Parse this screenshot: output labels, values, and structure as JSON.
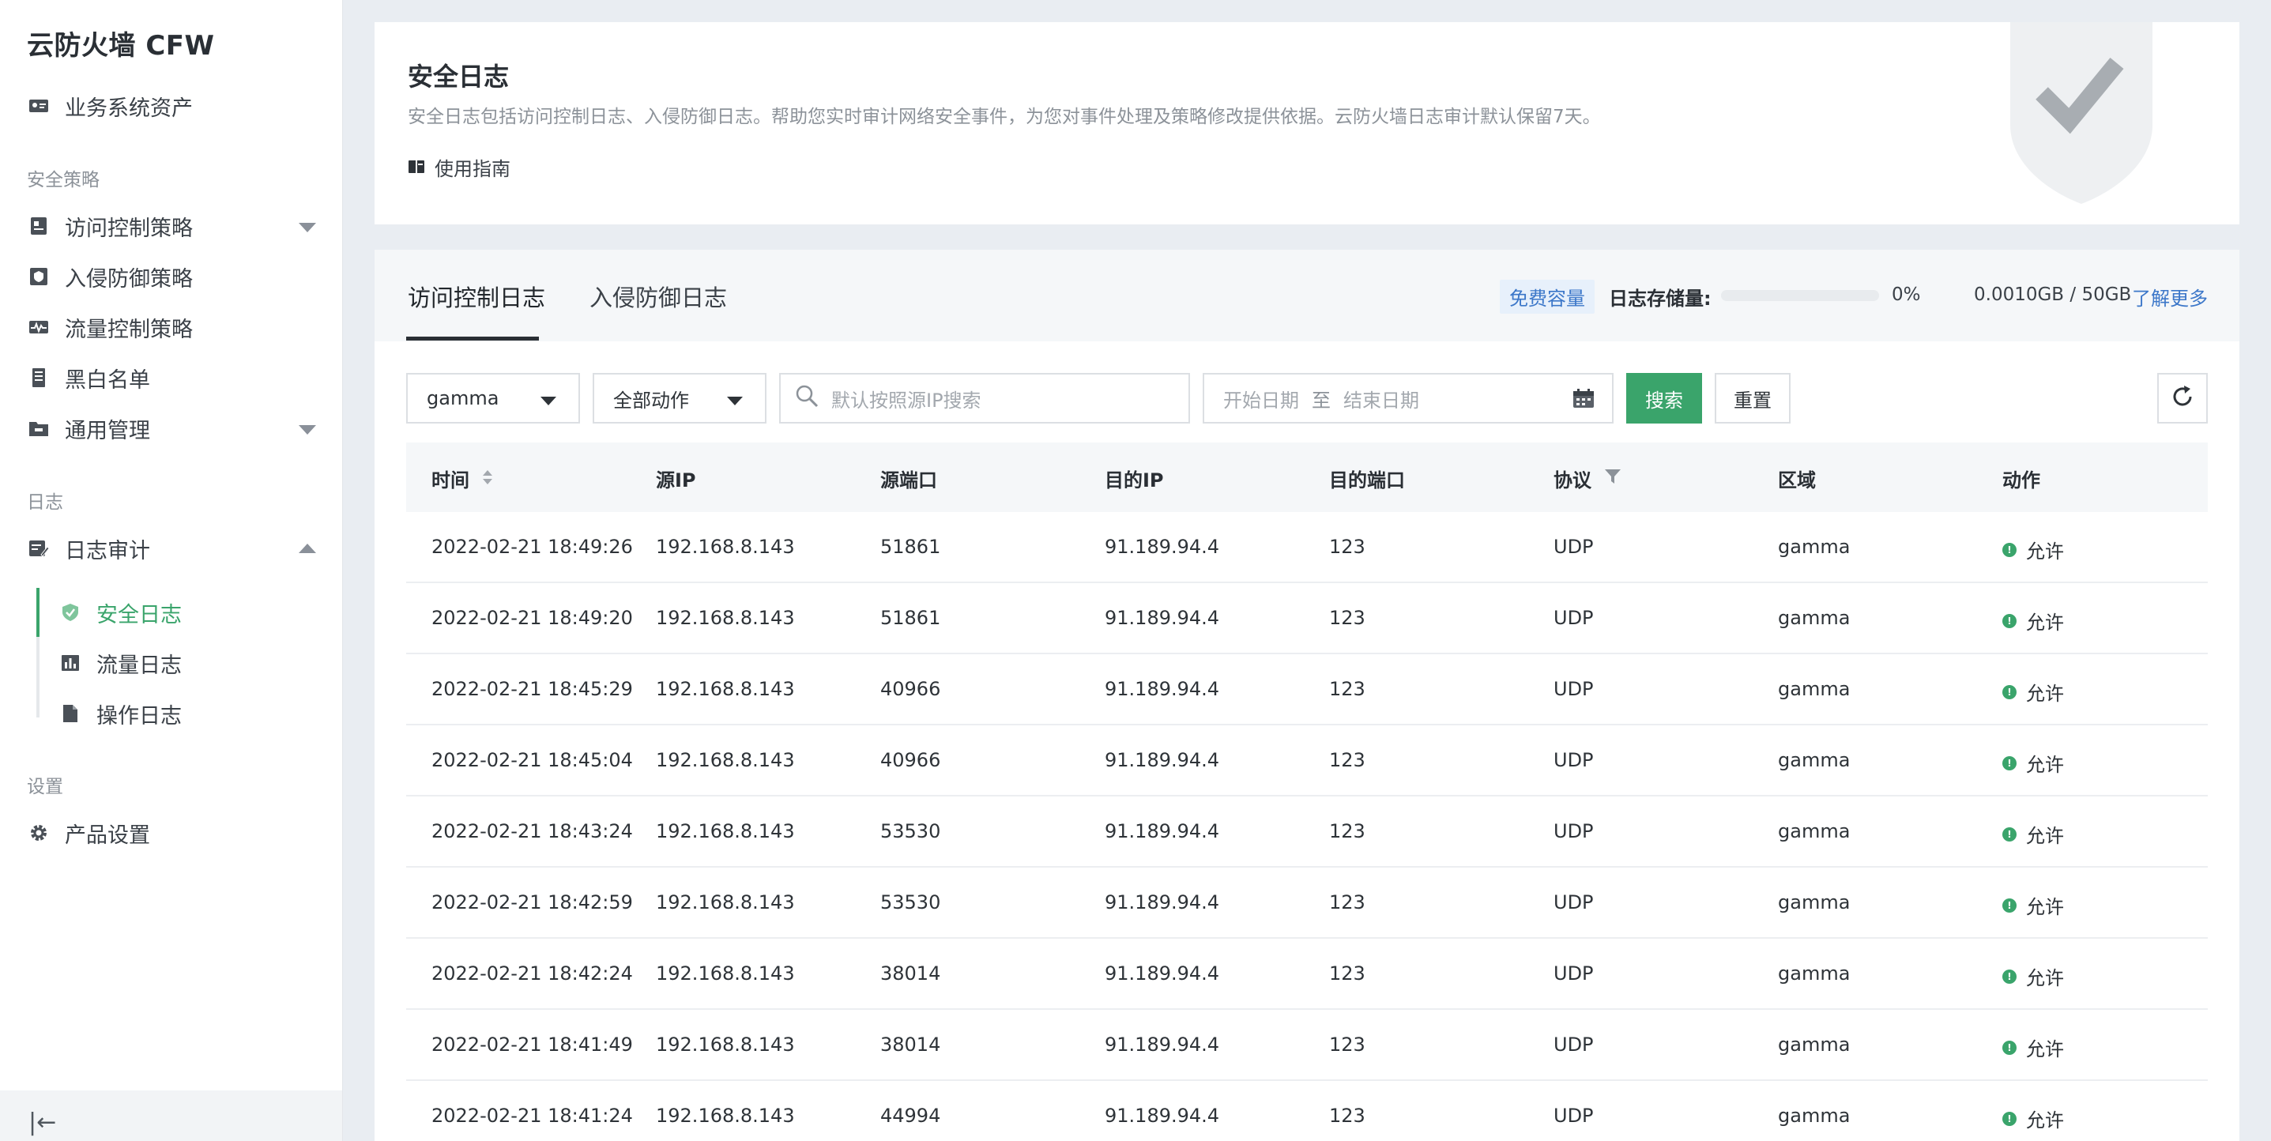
{
  "sidebar": {
    "brand": "云防火墙 CFW",
    "assets": "业务系统资产",
    "section_policy": "安全策略",
    "access_policy": "访问控制策略",
    "intrusion_policy": "入侵防御策略",
    "flow_policy": "流量控制策略",
    "blackwhite": "黑白名单",
    "general": "通用管理",
    "section_log": "日志",
    "log_audit": "日志审计",
    "security_log": "安全日志",
    "flow_log": "流量日志",
    "op_log": "操作日志",
    "section_settings": "设置",
    "product_settings": "产品设置",
    "collapse_glyph": "|←"
  },
  "header": {
    "title": "安全日志",
    "description": "安全日志包括访问控制日志、入侵防御日志。帮助您实时审计网络安全事件，为您对事件处理及策略修改提供依据。云防火墙日志审计默认保留7天。",
    "guide": "使用指南"
  },
  "tabs": {
    "access_log": "访问控制日志",
    "intrusion_log": "入侵防御日志"
  },
  "storage": {
    "badge": "免费容量",
    "label": "日志存储量:",
    "percent_text": "0%",
    "percent_value": 0,
    "capacity": "0.0010GB / 50GB",
    "learn_more": "了解更多"
  },
  "filters": {
    "region_value": "gamma",
    "action_value": "全部动作",
    "search_placeholder": "默认按照源IP搜索",
    "date_start_placeholder": "开始日期",
    "date_sep": "至",
    "date_end_placeholder": "结束日期",
    "search_button": "搜索",
    "reset_button": "重置"
  },
  "table": {
    "headers": [
      "时间",
      "源IP",
      "源端口",
      "目的IP",
      "目的端口",
      "协议",
      "区域",
      "动作"
    ],
    "rows": [
      [
        "2022-02-21 18:49:26",
        "192.168.8.143",
        "51861",
        "91.189.94.4",
        "123",
        "UDP",
        "gamma",
        "允许"
      ],
      [
        "2022-02-21 18:49:20",
        "192.168.8.143",
        "51861",
        "91.189.94.4",
        "123",
        "UDP",
        "gamma",
        "允许"
      ],
      [
        "2022-02-21 18:45:29",
        "192.168.8.143",
        "40966",
        "91.189.94.4",
        "123",
        "UDP",
        "gamma",
        "允许"
      ],
      [
        "2022-02-21 18:45:04",
        "192.168.8.143",
        "40966",
        "91.189.94.4",
        "123",
        "UDP",
        "gamma",
        "允许"
      ],
      [
        "2022-02-21 18:43:24",
        "192.168.8.143",
        "53530",
        "91.189.94.4",
        "123",
        "UDP",
        "gamma",
        "允许"
      ],
      [
        "2022-02-21 18:42:59",
        "192.168.8.143",
        "53530",
        "91.189.94.4",
        "123",
        "UDP",
        "gamma",
        "允许"
      ],
      [
        "2022-02-21 18:42:24",
        "192.168.8.143",
        "38014",
        "91.189.94.4",
        "123",
        "UDP",
        "gamma",
        "允许"
      ],
      [
        "2022-02-21 18:41:49",
        "192.168.8.143",
        "38014",
        "91.189.94.4",
        "123",
        "UDP",
        "gamma",
        "允许"
      ],
      [
        "2022-02-21 18:41:24",
        "192.168.8.143",
        "44994",
        "91.189.94.4",
        "123",
        "UDP",
        "gamma",
        "允许"
      ]
    ]
  },
  "colors": {
    "accent": "#3aa46b",
    "link": "#3c77c9",
    "background": "#e9edf2"
  },
  "icons": {
    "assets": "id-card-icon",
    "access_policy": "policy-doc-icon",
    "intrusion_policy": "shield-policy-icon",
    "flow_policy": "waveform-icon",
    "blackwhite": "list-icon",
    "general": "folder-icon",
    "log_audit": "edit-log-icon",
    "security_log": "shield-check-icon",
    "flow_log": "bar-chart-icon",
    "op_log": "file-icon",
    "product_settings": "gear-icon",
    "guide": "book-icon",
    "search": "search-icon",
    "calendar": "calendar-icon",
    "refresh": "refresh-icon",
    "sort": "sort-icon",
    "filter": "filter-icon"
  }
}
